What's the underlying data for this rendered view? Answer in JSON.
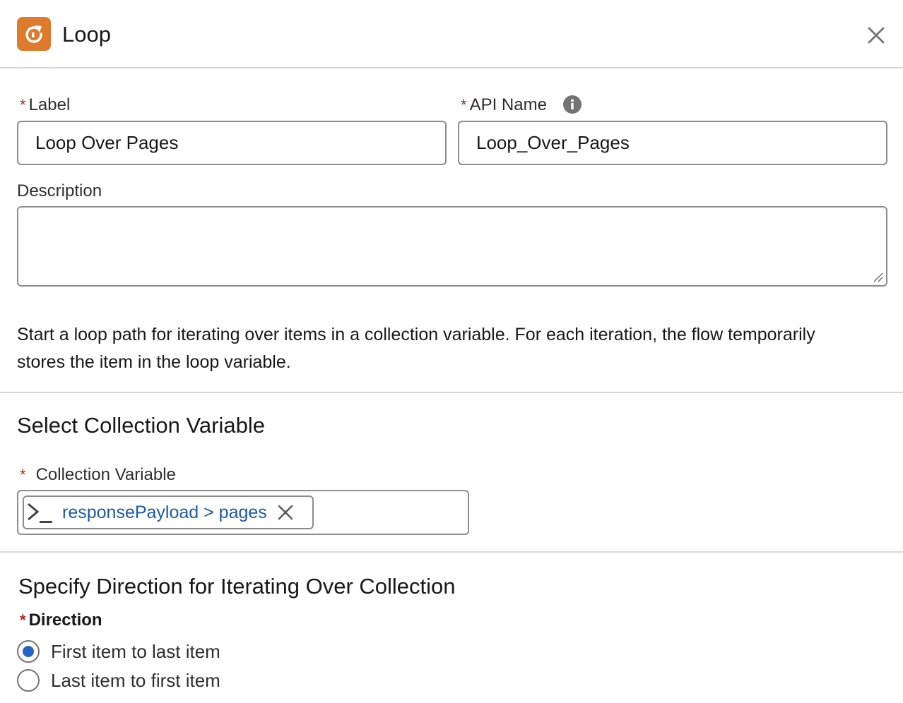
{
  "header": {
    "title": "Loop",
    "icon": "loop-icon",
    "icon_color": "#dd7a2b",
    "close_icon": "close-icon"
  },
  "form": {
    "label": {
      "required_mark": "*",
      "text": "Label",
      "value": "Loop Over Pages"
    },
    "api_name": {
      "required_mark": "*",
      "text": "API Name",
      "value": "Loop_Over_Pages",
      "info_icon": "info-icon"
    },
    "description": {
      "text": "Description",
      "value": ""
    },
    "help_text": "Start a loop path for iterating over items in a collection variable. For each iteration, the flow temporarily stores the item in the loop variable."
  },
  "collection_section": {
    "title": "Select Collection Variable",
    "field": {
      "required_mark": "*",
      "text": "Collection Variable",
      "pill_icon": "terminal-icon",
      "pill_value": "responsePayload > pages",
      "pill_remove_icon": "remove-icon"
    }
  },
  "direction_section": {
    "title": "Specify Direction for Iterating Over Collection",
    "field_label": "Direction",
    "required_mark": "*",
    "options": [
      {
        "label": "First item to last item",
        "selected": true
      },
      {
        "label": "Last item to first item",
        "selected": false
      }
    ],
    "accent_color": "#2563c9"
  }
}
